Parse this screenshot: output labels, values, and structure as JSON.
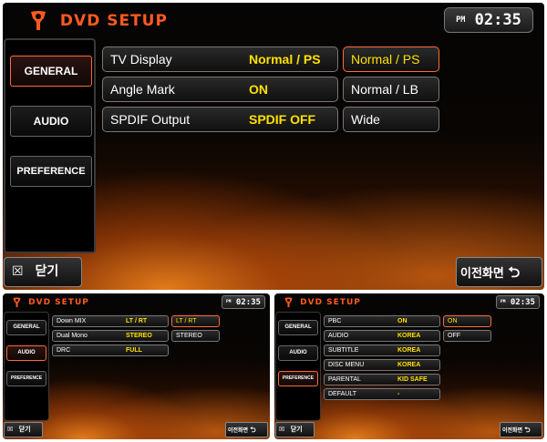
{
  "app": {
    "title": "DVD SETUP",
    "clock_period": "PM",
    "clock_time": "02:35",
    "close_label": "닫기",
    "back_label": "이전화면",
    "colors": {
      "accent": "#ff5a1e",
      "value": "#ffe000",
      "selected_border": "#ff6a3a"
    }
  },
  "sidebar": {
    "items": [
      {
        "label": "GENERAL"
      },
      {
        "label": "AUDIO"
      },
      {
        "label": "PREFERENCE"
      }
    ]
  },
  "general": {
    "rows": [
      {
        "label": "TV Display",
        "value": "Normal / PS"
      },
      {
        "label": "Angle Mark",
        "value": "ON"
      },
      {
        "label": "SPDIF Output",
        "value": "SPDIF OFF"
      }
    ],
    "options": [
      {
        "label": "Normal / PS",
        "selected": true
      },
      {
        "label": "Normal / LB",
        "selected": false
      },
      {
        "label": "Wide",
        "selected": false
      }
    ]
  },
  "audio": {
    "rows": [
      {
        "label": "Down MIX",
        "value": "LT / RT"
      },
      {
        "label": "Dual Mono",
        "value": "STEREO"
      },
      {
        "label": "DRC",
        "value": "FULL"
      }
    ],
    "options": [
      {
        "label": "LT / RT",
        "selected": true
      },
      {
        "label": "STEREO",
        "selected": false
      }
    ]
  },
  "preference": {
    "rows": [
      {
        "label": "PBC",
        "value": "ON"
      },
      {
        "label": "AUDIO",
        "value": "KOREA"
      },
      {
        "label": "SUBTITLE",
        "value": "KOREA"
      },
      {
        "label": "DISC MENU",
        "value": "KOREA"
      },
      {
        "label": "PARENTAL",
        "value": "KID SAFE"
      },
      {
        "label": "DEFAULT",
        "value": "-"
      }
    ],
    "options": [
      {
        "label": "ON",
        "selected": true
      },
      {
        "label": "OFF",
        "selected": false
      }
    ]
  }
}
